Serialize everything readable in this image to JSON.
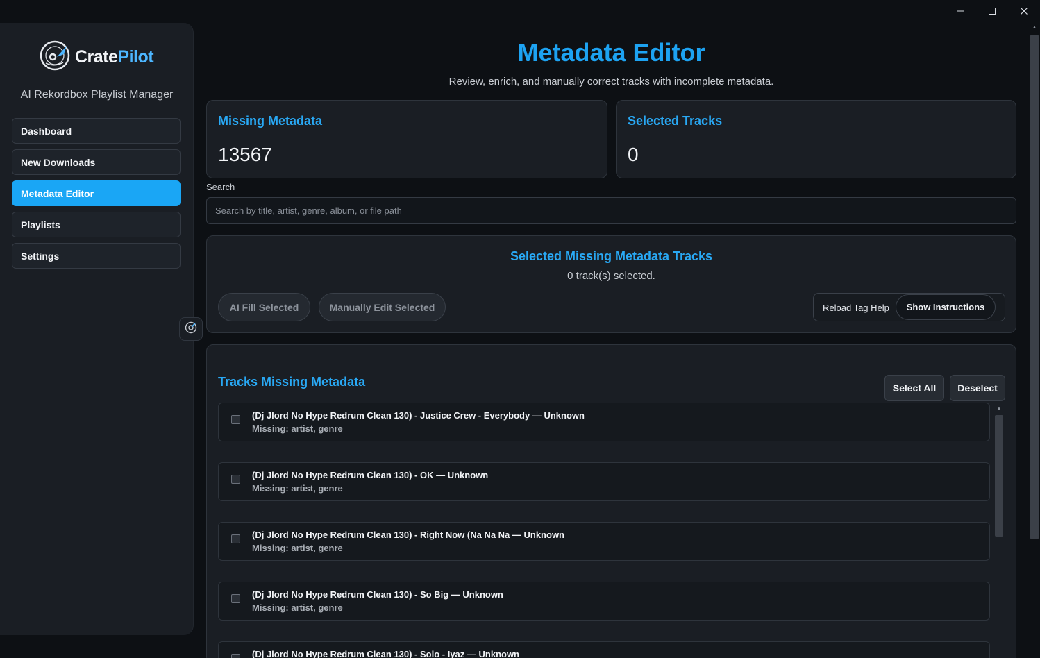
{
  "window": {
    "minimize_icon": "minimize-icon",
    "maximize_icon": "maximize-icon",
    "close_icon": "close-icon"
  },
  "sidebar": {
    "logo": {
      "part1": "Crate",
      "part2": "Pilot",
      "icon": "vinyl-record-icon"
    },
    "subtitle": "AI Rekordbox Playlist Manager",
    "items": [
      {
        "label": "Dashboard",
        "active": false
      },
      {
        "label": "New Downloads",
        "active": false
      },
      {
        "label": "Metadata Editor",
        "active": true
      },
      {
        "label": "Playlists",
        "active": false
      },
      {
        "label": "Settings",
        "active": false
      }
    ],
    "collapse_icon": "disc-icon"
  },
  "header": {
    "title": "Metadata Editor",
    "subtitle": "Review, enrich, and manually correct tracks with incomplete metadata."
  },
  "stats": {
    "missing": {
      "label": "Missing Metadata",
      "value": "13567"
    },
    "selected": {
      "label": "Selected Tracks",
      "value": "0"
    }
  },
  "search": {
    "label": "Search",
    "value": "",
    "placeholder": "Search by title, artist, genre, album, or file path"
  },
  "selection_panel": {
    "title": "Selected Missing Metadata Tracks",
    "count_text": "0 track(s) selected.",
    "ai_fill_label": "AI Fill Selected",
    "manual_edit_label": "Manually Edit Selected",
    "reload_help_label": "Reload Tag Help",
    "show_instructions_label": "Show Instructions"
  },
  "tracks_panel": {
    "title": "Tracks Missing Metadata",
    "select_all_label": "Select All",
    "deselect_label": "Deselect",
    "tracks": [
      {
        "title": "(Dj Jlord No Hype Redrum Clean 130) - Justice Crew - Everybody — Unknown",
        "missing": "Missing: artist, genre",
        "checked": false
      },
      {
        "title": "(Dj Jlord No Hype Redrum Clean 130) - OK — Unknown",
        "missing": "Missing: artist, genre",
        "checked": false
      },
      {
        "title": "(Dj Jlord No Hype Redrum Clean 130) - Right Now (Na Na Na — Unknown",
        "missing": "Missing: artist, genre",
        "checked": false
      },
      {
        "title": "(Dj Jlord No Hype Redrum Clean 130) - So Big — Unknown",
        "missing": "Missing: artist, genre",
        "checked": false
      },
      {
        "title": "(Dj Jlord No Hype Redrum Clean 130) - Solo - Iyaz — Unknown",
        "missing": "",
        "checked": false
      }
    ]
  },
  "colors": {
    "accent": "#1da3f2",
    "active_nav": "#1aa6f5",
    "background": "#0d1014",
    "panel": "#1a1e24"
  }
}
